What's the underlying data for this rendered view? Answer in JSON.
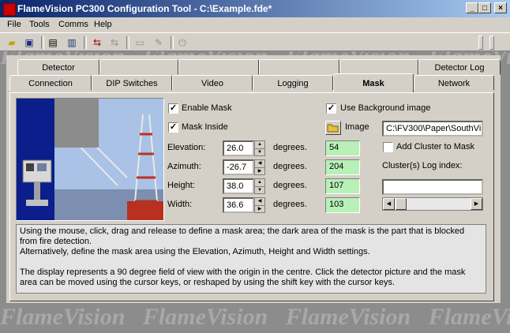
{
  "window": {
    "title": "FlameVision PC300 Configuration Tool - C:\\Example.fde*",
    "controls": {
      "minimize": "_",
      "maximize": "□",
      "close": "×"
    }
  },
  "menu": [
    "File",
    "Tools",
    "Comms",
    "Help"
  ],
  "toolbar": {
    "icons": [
      "open-folder",
      "save",
      "print",
      "device-info",
      "connect",
      "disconnect",
      "detector",
      "pen",
      "power"
    ]
  },
  "watermark": "FlameVision",
  "tabs": {
    "back_row": [
      "Detector",
      "",
      "",
      "",
      "",
      "Detector Log"
    ],
    "front_row": [
      "Connection",
      "DIP Switches",
      "Video",
      "Logging",
      "Mask",
      "Network"
    ],
    "active": "Mask"
  },
  "mask": {
    "enable_mask": {
      "label": "Enable Mask",
      "checked": true
    },
    "mask_inside": {
      "label": "Mask Inside",
      "checked": true
    },
    "fields": [
      {
        "label": "Elevation:",
        "value": "26.0",
        "unit": "degrees.",
        "raw": "54"
      },
      {
        "label": "Azimuth:",
        "value": "-26.7",
        "unit": "degrees.",
        "raw": "204"
      },
      {
        "label": "Height:",
        "value": "38.0",
        "unit": "degrees.",
        "raw": "107"
      },
      {
        "label": "Width:",
        "value": "36.6",
        "unit": "degrees.",
        "raw": "103"
      }
    ],
    "use_background": {
      "label": "Use Background image",
      "checked": true
    },
    "image_label": "Image",
    "image_path": "C:\\FV300\\Paper\\SouthVi",
    "add_cluster": {
      "label": "Add Cluster to Mask",
      "checked": false
    },
    "cluster_log_label": "Cluster(s) Log index:",
    "cluster_log_value": "",
    "help_text": "Using the mouse, click, drag and release to define a mask area; the dark area of the mask is the part that is blocked from fire detection.\nAlternatively, define the mask area using the Elevation, Azimuth, Height and Width settings.\n\nThe display represents a 90 degree field of view with the origin in the centre. Click the detector picture and the mask area can be moved using the cursor keys, or reshaped by using the shift key with the cursor keys."
  },
  "colors": {
    "titlebar_start": "#0a246a",
    "titlebar_end": "#a6caf0",
    "raw_value_bg": "#b8f0b8",
    "preview_bg": "#0b1e8c"
  }
}
